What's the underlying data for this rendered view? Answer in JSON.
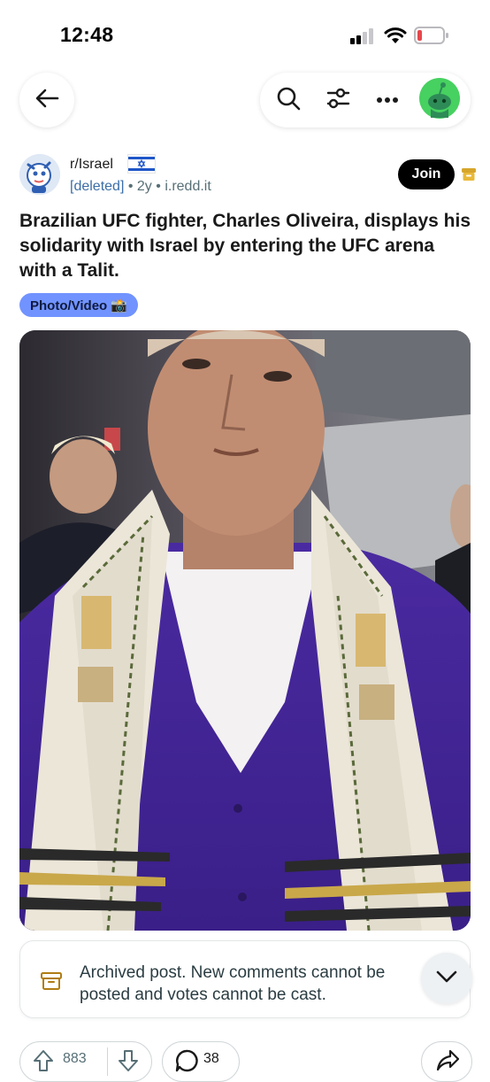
{
  "status_bar": {
    "time": "12:48",
    "icons": [
      "cellular-signal-icon",
      "wifi-icon",
      "battery-low-icon"
    ],
    "battery_color": "#e5484d"
  },
  "nav": {
    "icons": [
      "back-arrow-icon",
      "search-icon",
      "filter-icon",
      "more-icon",
      "user-avatar-icon"
    ],
    "avatar_color": "#46d160"
  },
  "post": {
    "subreddit": "r/Israel",
    "author": "[deleted]",
    "age": "2y",
    "domain": "i.redd.it",
    "separator": "•",
    "join_label": "Join",
    "title": "Brazilian UFC fighter, Charles Oliveira, displays his solidarity with Israel by entering the UFC arena with a Talit.",
    "flair": "Photo/Video 📸",
    "flair_color": "#7193ff"
  },
  "notice": {
    "text_line1": "Archived post. New comments cannot be",
    "text_line2": "posted and votes cannot be cast.",
    "icon": "archive-icon"
  },
  "actions": {
    "votes": "883",
    "comments": "38",
    "icons": [
      "upvote-icon",
      "downvote-icon",
      "comment-icon",
      "share-icon"
    ]
  }
}
